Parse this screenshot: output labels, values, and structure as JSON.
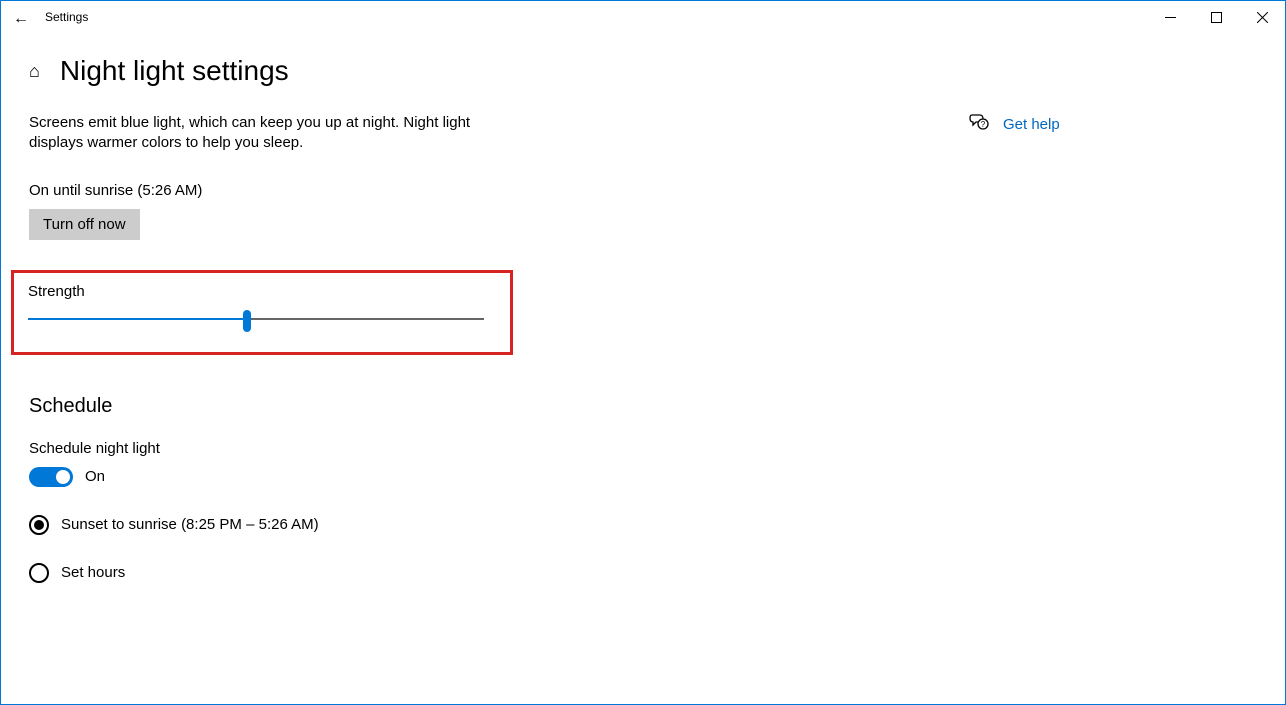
{
  "window": {
    "app_title": "Settings"
  },
  "header": {
    "page_title": "Night light settings"
  },
  "main": {
    "description": "Screens emit blue light, which can keep you up at night. Night light displays warmer colors to help you sleep.",
    "status": "On until sunrise (5:26 AM)",
    "turn_off_label": "Turn off now",
    "strength_label": "Strength",
    "strength_value": 48
  },
  "schedule": {
    "heading": "Schedule",
    "label": "Schedule night light",
    "toggle_state": "On",
    "option_sunset": "Sunset to sunrise (8:25 PM – 5:26 AM)",
    "option_sethours": "Set hours"
  },
  "help": {
    "label": "Get help"
  }
}
